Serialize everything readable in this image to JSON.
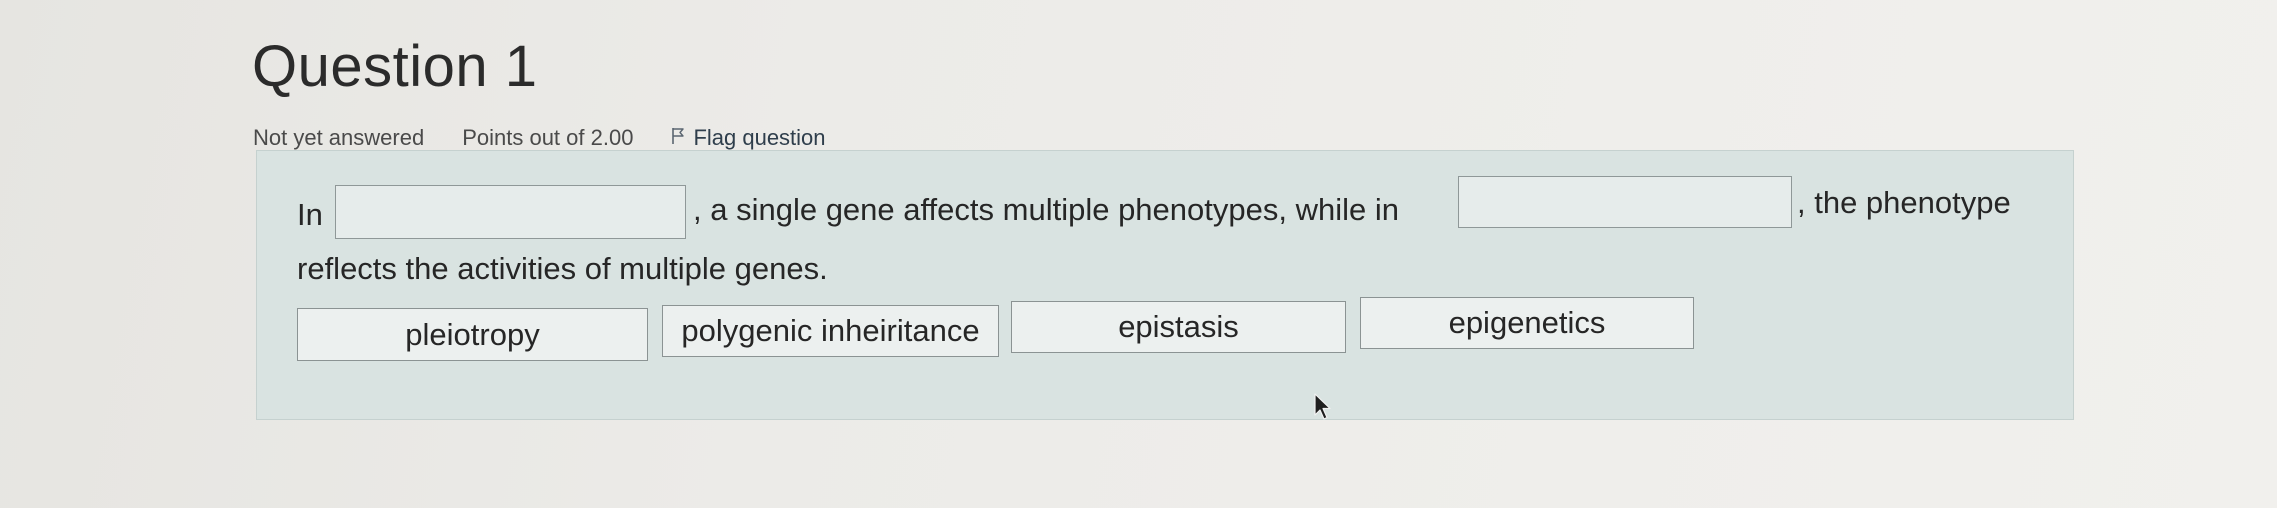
{
  "question": {
    "title": "Question 1",
    "status": "Not yet answered",
    "points": "Points out of 2.00",
    "flag_label": "Flag question"
  },
  "question_text": {
    "part1": "In",
    "part2": ", a single gene affects multiple phenotypes, while in",
    "part3": ", the phenotype",
    "part4": "reflects the activities of multiple genes."
  },
  "blanks": [
    "",
    ""
  ],
  "choices": [
    "pleiotropy",
    "polygenic inheiritance",
    "epistasis",
    "epigenetics"
  ],
  "icons": {
    "flag": "flag-icon",
    "cursor": "mouse-pointer-icon"
  },
  "colors": {
    "content_background": "#d9e3e1",
    "title_text": "#2b2b2b",
    "flag_link": "#2f3e4c"
  }
}
